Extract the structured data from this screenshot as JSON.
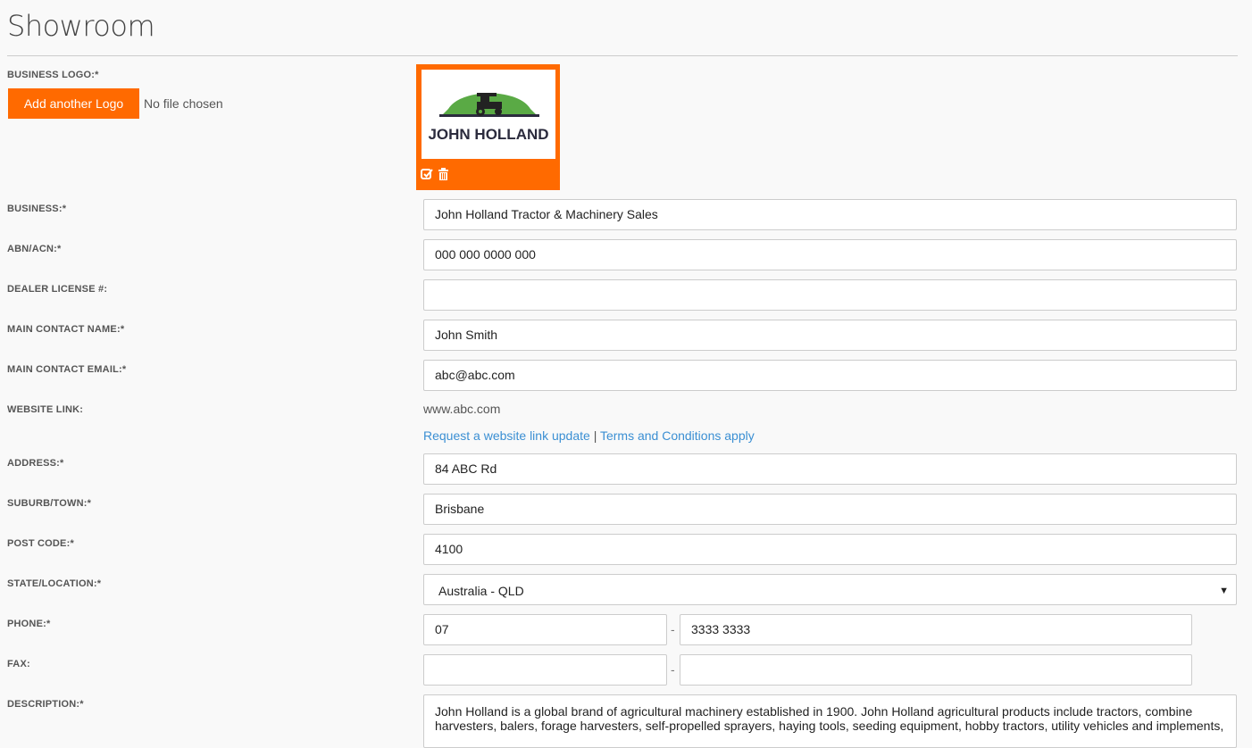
{
  "page": {
    "title": "Showroom"
  },
  "logo": {
    "label": "BUSINESS LOGO:*",
    "button_label": "Add another Logo",
    "file_status": "No file chosen",
    "brand_text": "JOHN HOLLAND"
  },
  "fields": {
    "business": {
      "label": "BUSINESS:*",
      "value": "John Holland Tractor & Machinery Sales"
    },
    "abn": {
      "label": "ABN/ACN:*",
      "value": "000 000 0000 000"
    },
    "dealer_license": {
      "label": "DEALER LICENSE #:",
      "value": ""
    },
    "contact_name": {
      "label": "MAIN CONTACT NAME:*",
      "value": "John Smith"
    },
    "contact_email": {
      "label": "MAIN CONTACT EMAIL:*",
      "value": "abc@abc.com"
    },
    "website": {
      "label": "WEBSITE LINK:",
      "value": "www.abc.com",
      "update_link": "Request a website link update",
      "separator": "|",
      "terms_link": "Terms and Conditions apply"
    },
    "address": {
      "label": "ADDRESS:*",
      "value": "84 ABC Rd"
    },
    "suburb": {
      "label": "SUBURB/TOWN:*",
      "value": "Brisbane"
    },
    "postcode": {
      "label": "POST CODE:*",
      "value": "4100"
    },
    "state": {
      "label": "STATE/LOCATION:*",
      "value": "Australia - QLD"
    },
    "phone": {
      "label": "PHONE:*",
      "area": "07",
      "number": "3333 3333",
      "dash": "-"
    },
    "fax": {
      "label": "FAX:",
      "area": "",
      "number": "",
      "dash": "-"
    },
    "description": {
      "label": "DESCRIPTION:*",
      "value": "John Holland is a global brand of agricultural machinery established in 1900. John Holland agricultural products include tractors, combine harvesters, balers, forage harvesters, self-propelled sprayers, haying tools, seeding equipment, hobby tractors, utility vehicles and implements,"
    }
  },
  "colors": {
    "accent": "#ff6a00",
    "link": "#3b8fd3",
    "logo_green": "#5aaa45"
  }
}
